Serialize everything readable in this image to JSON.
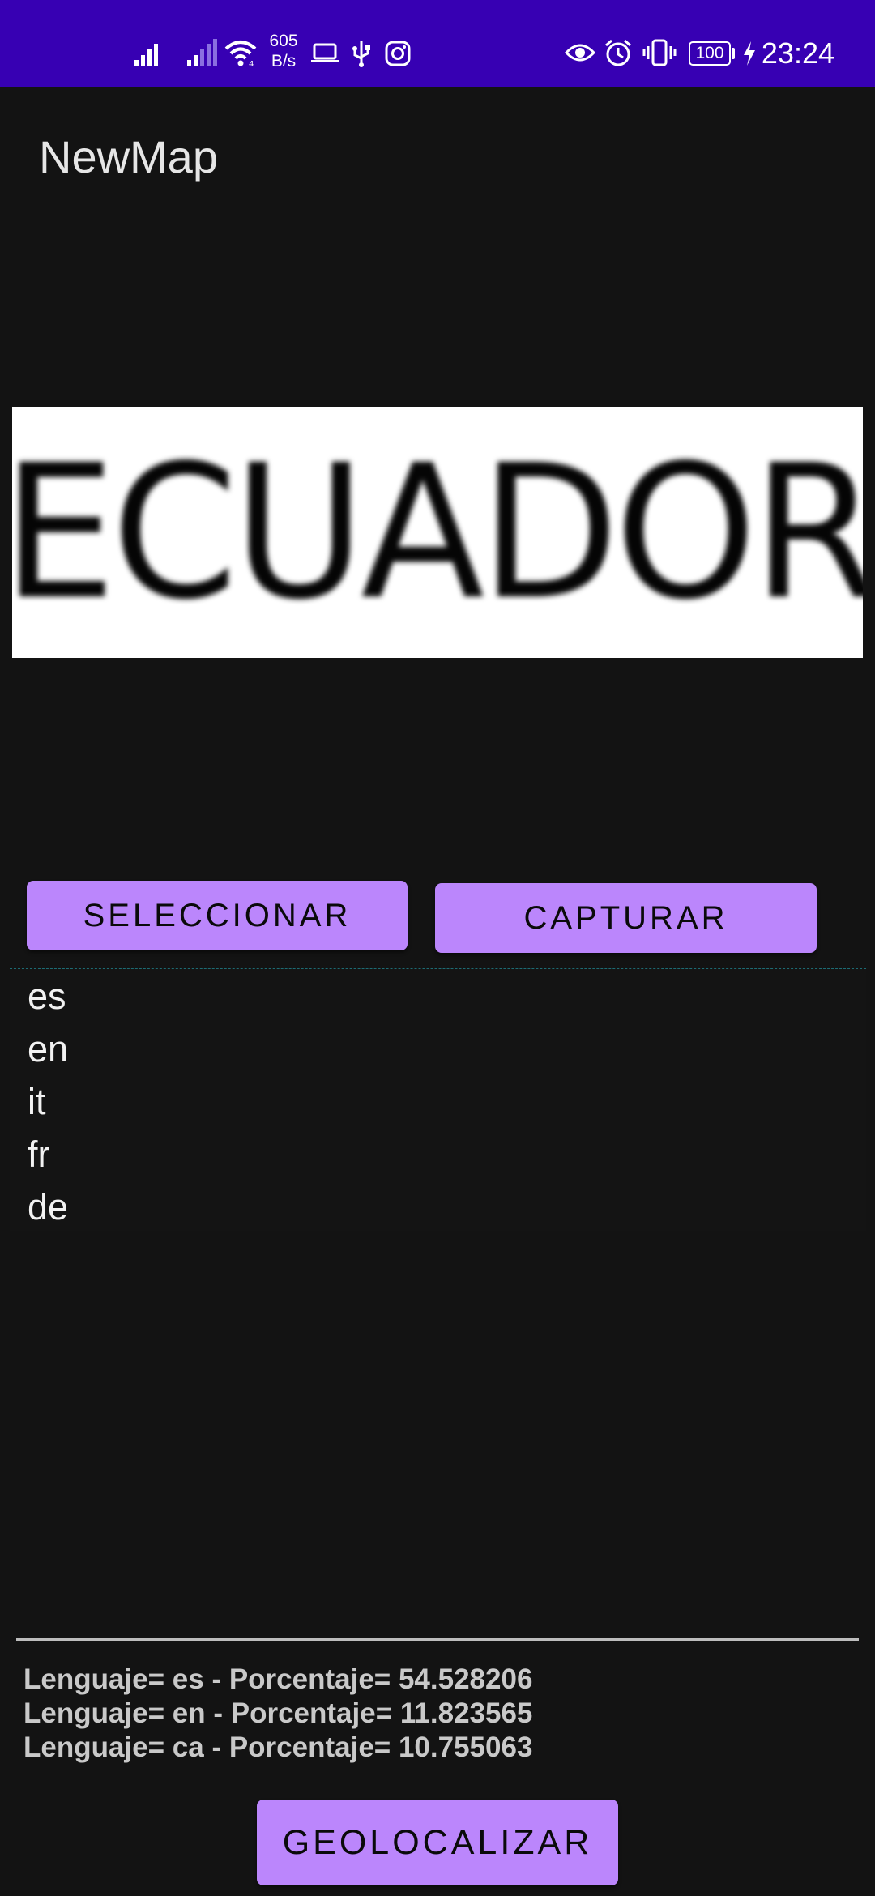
{
  "status_bar": {
    "net_speed_value": "605",
    "net_speed_unit": "B/s",
    "battery": "100",
    "time": "23:24",
    "icons": [
      "signal-icon",
      "signal-weak-icon",
      "wifi-icon",
      "laptop-icon",
      "usb-icon",
      "instagram-icon",
      "eye-icon",
      "alarm-icon",
      "vibrate-icon",
      "battery-icon",
      "charging-icon"
    ]
  },
  "app_bar": {
    "title": "NewMap"
  },
  "photo": {
    "word": "ECUADOR"
  },
  "buttons": {
    "select_label": "SELECCIONAR",
    "capture_label": "CAPTURAR",
    "geolocate_label": "GEOLOCALIZAR"
  },
  "language_list": [
    "es",
    "en",
    "it",
    "fr",
    "de"
  ],
  "results": [
    "Lenguaje= es - Porcentaje= 54.528206",
    "Lenguaje= en - Porcentaje= 11.823565",
    "Lenguaje= ca - Porcentaje= 10.755063"
  ],
  "colors": {
    "status_bar": "#3700b3",
    "button": "#bb86fc",
    "background": "#131313"
  }
}
